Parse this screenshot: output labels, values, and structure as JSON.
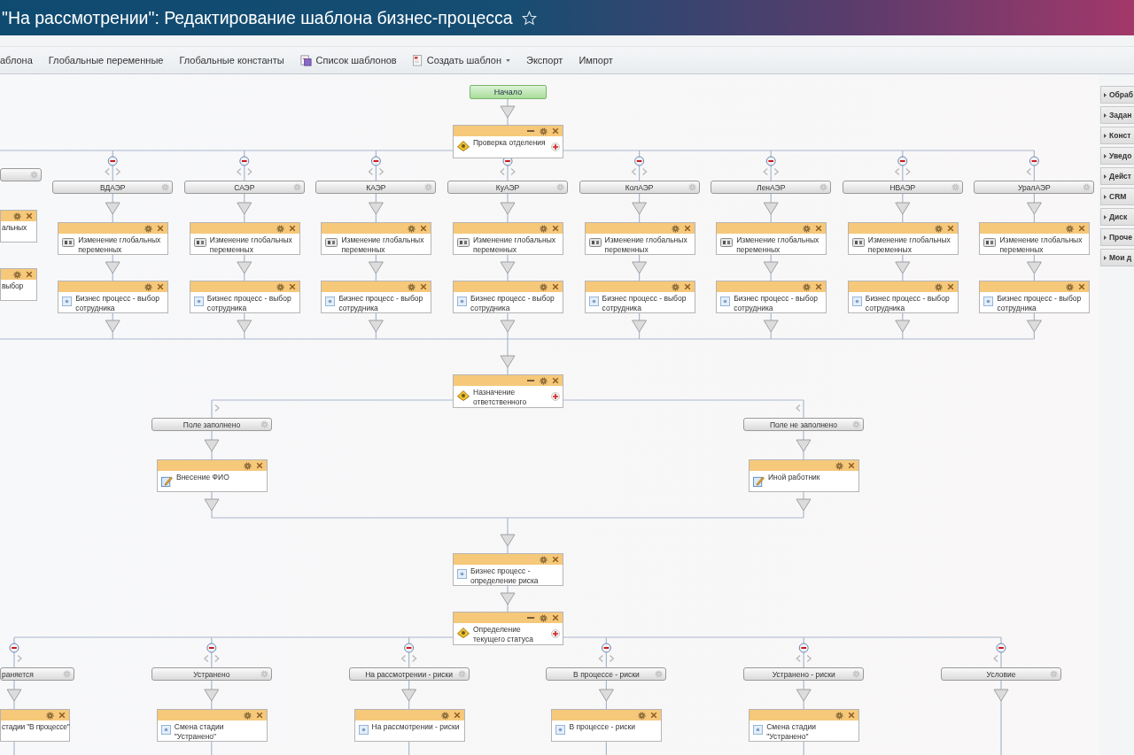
{
  "window": {
    "title": "\"На рассмотрении\": Редактирование шаблона бизнес-процесса"
  },
  "toolbar": [
    {
      "kind": "link",
      "label": "аблона"
    },
    {
      "kind": "link",
      "label": "Глобальные переменные"
    },
    {
      "kind": "link",
      "label": "Глобальные константы"
    },
    {
      "kind": "list",
      "label": "Список шаблонов"
    },
    {
      "kind": "menu",
      "label": "Создать шаблон"
    },
    {
      "kind": "link",
      "label": "Экспорт"
    },
    {
      "kind": "link",
      "label": "Импорт"
    }
  ],
  "side_panel": [
    {
      "label": "Обраб"
    },
    {
      "label": "Задан"
    },
    {
      "label": "Конст"
    },
    {
      "label": "Уведо"
    },
    {
      "label": "Дейст"
    },
    {
      "label": "CRM"
    },
    {
      "label": "Диск"
    },
    {
      "label": "Проче"
    },
    {
      "label": "Мои д"
    }
  ],
  "diagram": {
    "start": {
      "label": "Начало"
    },
    "blocks": [
      {
        "kind": "branching",
        "title": "Проверка отделения",
        "branches": [
          {
            "steps": [
              {
                "text": "альных"
              },
              {
                "text": "выбор"
              }
            ]
          },
          {
            "label": "ВДАЭР",
            "removable": true,
            "move_left": true,
            "move_right": true,
            "steps": [
              {
                "kind": "variables",
                "text": "Изменение глобальных переменных"
              },
              {
                "kind": "process",
                "text": "Бизнес процесс - выбор сотрудника"
              }
            ]
          },
          {
            "label": "САЭР",
            "removable": true,
            "move_left": true,
            "move_right": true,
            "steps": [
              {
                "kind": "variables",
                "text": "Изменение глобальных переменных"
              },
              {
                "kind": "process",
                "text": "Бизнес процесс - выбор сотрудника"
              }
            ]
          },
          {
            "label": "КАЭР",
            "removable": true,
            "move_left": true,
            "move_right": true,
            "steps": [
              {
                "kind": "variables",
                "text": "Изменение глобальных переменных"
              },
              {
                "kind": "process",
                "text": "Бизнес процесс - выбор сотрудника"
              }
            ]
          },
          {
            "label": "КуАЭР",
            "removable": true,
            "move_left": true,
            "move_right": true,
            "steps": [
              {
                "kind": "variables",
                "text": "Изменение глобальных переменных"
              },
              {
                "kind": "process",
                "text": "Бизнес процесс - выбор сотрудника"
              }
            ]
          },
          {
            "label": "КолАЭР",
            "removable": true,
            "move_left": true,
            "move_right": true,
            "steps": [
              {
                "kind": "variables",
                "text": "Изменение глобальных переменных"
              },
              {
                "kind": "process",
                "text": "Бизнес процесс - выбор сотрудника"
              }
            ]
          },
          {
            "label": "ЛенАЭР",
            "removable": true,
            "move_left": true,
            "move_right": true,
            "steps": [
              {
                "kind": "variables",
                "text": "Изменение глобальных переменных"
              },
              {
                "kind": "process",
                "text": "Бизнес процесс - выбор сотрудника"
              }
            ]
          },
          {
            "label": "НВАЭР",
            "removable": true,
            "move_left": true,
            "move_right": true,
            "steps": [
              {
                "kind": "variables",
                "text": "Изменение глобальных переменных"
              },
              {
                "kind": "process",
                "text": "Бизнес процесс - выбор сотрудника"
              }
            ]
          },
          {
            "label": "УралАЭР",
            "removable": true,
            "move_left": true,
            "steps": [
              {
                "kind": "variables",
                "text": "Изменение глобальных переменных"
              },
              {
                "kind": "process",
                "text": "Бизнес процесс - выбор сотрудника"
              }
            ]
          }
        ]
      },
      {
        "kind": "branching",
        "title": "Назначение ответственного",
        "branches": [
          {
            "label": "Поле заполнено",
            "move_right": true,
            "steps": [
              {
                "kind": "form",
                "text": "Внесение ФИО"
              }
            ]
          },
          {
            "label": "Поле не заполнено",
            "move_left": true,
            "steps": [
              {
                "kind": "form",
                "text": "Иной работник"
              }
            ]
          }
        ]
      },
      {
        "kind": "activity",
        "step": {
          "kind": "process",
          "text": "Бизнес процесс - определение риска"
        }
      },
      {
        "kind": "branching",
        "title": "Определение текущего статуса",
        "branches": [
          {
            "label": "раняется",
            "removable": true,
            "move_right": true,
            "steps": [
              {
                "text": "стадии \"В процессе\""
              }
            ]
          },
          {
            "label": "Устранено",
            "removable": true,
            "move_left": true,
            "move_right": true,
            "steps": [
              {
                "kind": "process",
                "text": "Смена стадии \"Устранено\""
              }
            ]
          },
          {
            "label": "На рассмотрении - риски",
            "removable": true,
            "move_left": true,
            "move_right": true,
            "steps": [
              {
                "kind": "process",
                "text": "На рассмотрении - риски"
              }
            ]
          },
          {
            "label": "В процессе - риски",
            "removable": true,
            "move_left": true,
            "move_right": true,
            "steps": [
              {
                "kind": "process",
                "text": "В процессе - риски"
              }
            ]
          },
          {
            "label": "Устранено - риски",
            "removable": true,
            "move_left": true,
            "move_right": true,
            "steps": [
              {
                "kind": "process",
                "text": "Смена стадии \"Устранено\""
              }
            ]
          },
          {
            "label": "Условие",
            "removable": true,
            "move_left": true
          }
        ]
      }
    ]
  }
}
